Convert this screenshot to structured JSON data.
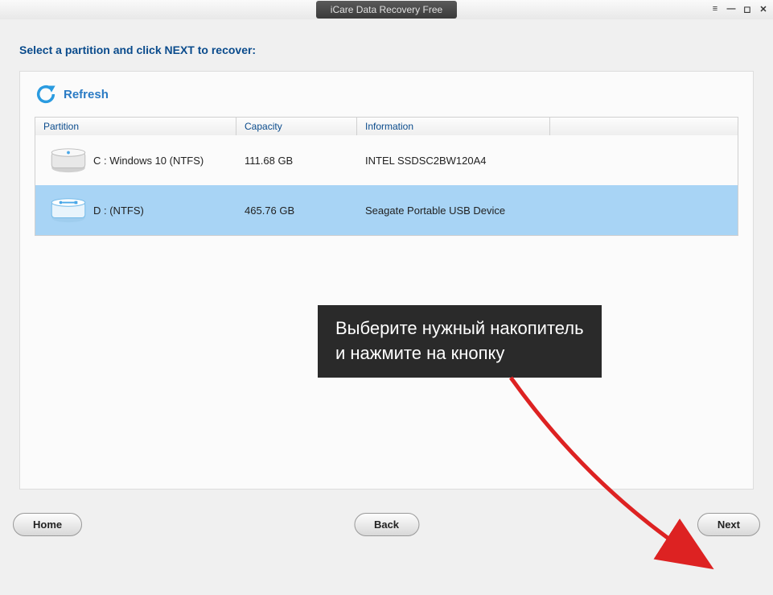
{
  "title": "iCare Data Recovery Free",
  "instruction": "Select a partition and click NEXT to recover:",
  "refresh_label": "Refresh",
  "columns": {
    "partition": "Partition",
    "capacity": "Capacity",
    "information": "Information"
  },
  "rows": [
    {
      "partition": "C : Windows 10  (NTFS)",
      "capacity": "111.68 GB",
      "info": "INTEL SSDSC2BW120A4",
      "selected": false
    },
    {
      "partition": "D :   (NTFS)",
      "capacity": "465.76 GB",
      "info": "Seagate  Portable   USB Device",
      "selected": true
    }
  ],
  "tooltip": {
    "line1": "Выберите нужный накопитель",
    "line2": "и нажмите на кнопку"
  },
  "buttons": {
    "home": "Home",
    "back": "Back",
    "next": "Next"
  }
}
